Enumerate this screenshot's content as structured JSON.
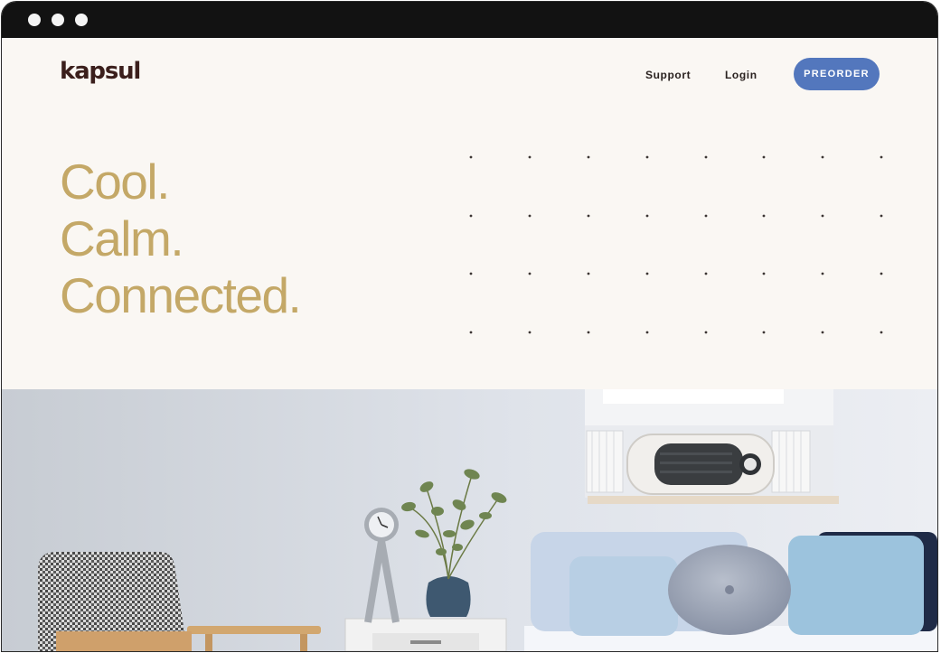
{
  "nav": {
    "logo": "kapsul",
    "support": "Support",
    "login": "Login",
    "preorder": "PREORDER"
  },
  "hero": {
    "lines": [
      "Cool.",
      "Calm.",
      "Connected."
    ]
  },
  "colors": {
    "accent": "#5377bd",
    "headline": "#c4a867",
    "background": "#faf7f3",
    "logo": "#3b1f1c"
  }
}
